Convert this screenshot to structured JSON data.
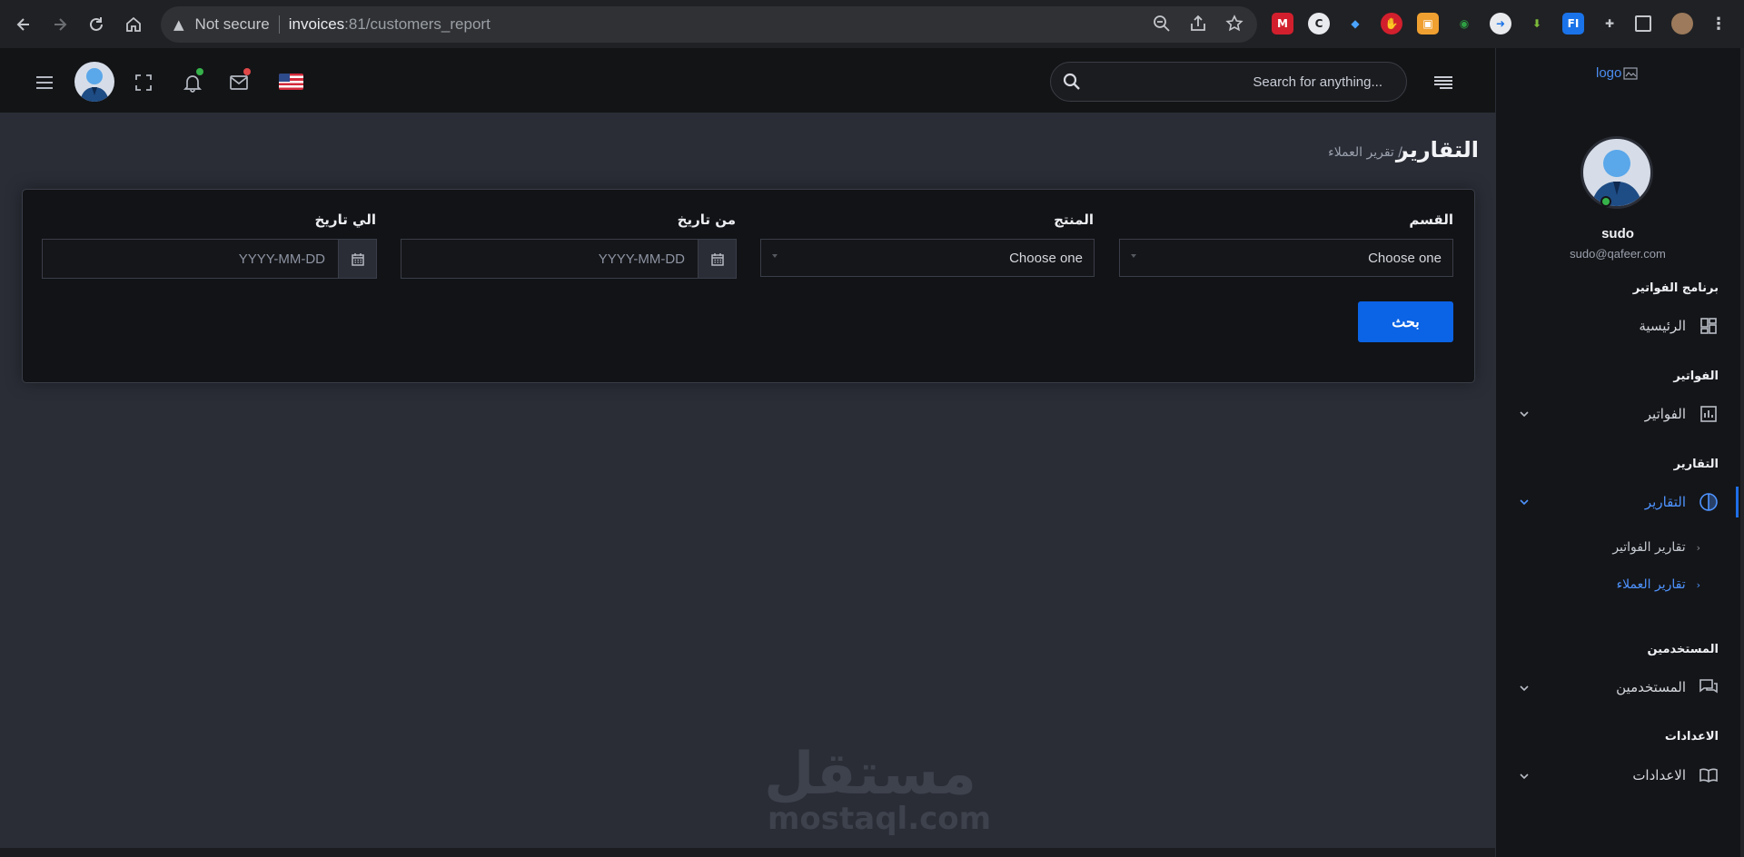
{
  "browser": {
    "not_secure": "Not secure",
    "url_host": "invoices",
    "url_path": ":81/customers_report"
  },
  "topbar": {
    "search_placeholder": "...Search for anything"
  },
  "page": {
    "title": "التقارير",
    "breadcrumb": "/ تقرير العملاء"
  },
  "filters": {
    "department_label": "القسم",
    "department_value": "Choose one",
    "product_label": "المنتج",
    "product_value": "Choose one",
    "from_date_label": "من تاريخ",
    "from_date_placeholder": "YYYY-MM-DD",
    "to_date_label": "الي تاريخ",
    "to_date_placeholder": "YYYY-MM-DD",
    "search_button": "بحث"
  },
  "watermark": {
    "arabic": "مستقل",
    "latin": "mostaql.com"
  },
  "sidebar": {
    "logo": "logo",
    "user_name": "sudo",
    "user_email": "sudo@qafeer.com",
    "sections": [
      {
        "title": "برنامج الفواتير",
        "item": "الرئيسية"
      },
      {
        "title": "الفواتير",
        "item": "الفواتير"
      },
      {
        "title": "التقارير",
        "item": "التقارير"
      },
      {
        "title": "المستخدمين",
        "item": "المستخدمين"
      },
      {
        "title": "الاعدادات",
        "item": "الاعدادات"
      }
    ],
    "submenu": [
      "تقارير الفواتير",
      "تقارير العملاء"
    ]
  },
  "colors": {
    "accent": "#0b63e5",
    "active_link": "#4e93ff",
    "online": "#36b24a"
  }
}
